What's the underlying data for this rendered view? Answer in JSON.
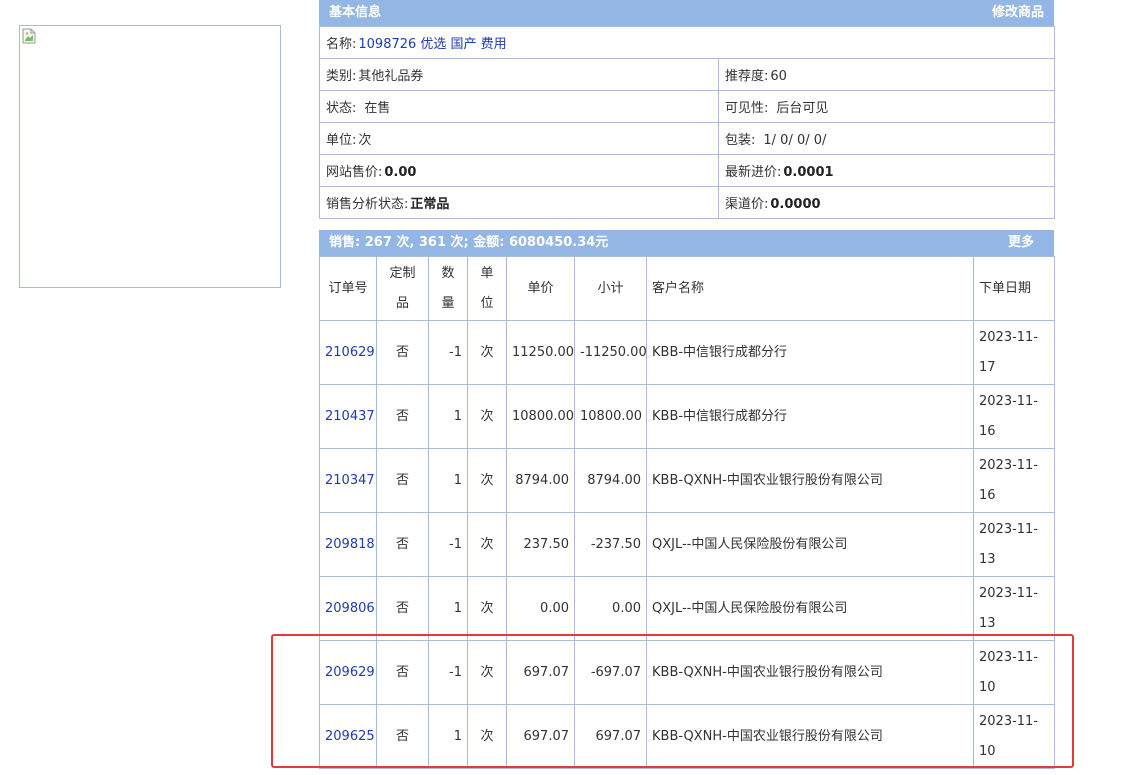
{
  "basic": {
    "header_title": "基本信息",
    "edit_link": "修改商品",
    "name_label": "名称:",
    "name_value": "1098726 优选 国产 费用",
    "category_label": "类别:",
    "category_value": "其他礼品券",
    "recommend_label": "推荐度:",
    "recommend_value": "60",
    "status_label": "状态:",
    "status_value": "在售",
    "visibility_label": "可见性:",
    "visibility_value": "后台可见",
    "unit_label": "单位:",
    "unit_value": "次",
    "package_label": "包装:",
    "package_value": "1/ 0/ 0/ 0/",
    "web_price_label": "网站售价:",
    "web_price_value": "0.00",
    "latest_cost_label": "最新进价:",
    "latest_cost_value": "0.0001",
    "sales_status_label": "销售分析状态:",
    "sales_status_value": "正常品",
    "channel_price_label": "渠道价:",
    "channel_price_value": "0.0000"
  },
  "sales": {
    "header_title": "销售: 267 次, 361 次; 金额: 6080450.34元",
    "more_link": "更多",
    "columns": {
      "order_no": "订单号",
      "custom_1": "定制",
      "custom_2": "品",
      "qty_1": "数",
      "qty_2": "量",
      "unit_1": "单",
      "unit_2": "位",
      "price": "单价",
      "subtotal": "小计",
      "customer": "客户名称",
      "date": "下单日期"
    },
    "rows": [
      {
        "order_no": "210629",
        "custom": "否",
        "qty": "-1",
        "unit": "次",
        "price": "11250.00",
        "subtotal": "-11250.00",
        "customer": "KBB-中信银行成都分行",
        "date_1": "2023-11-",
        "date_2": "17"
      },
      {
        "order_no": "210437",
        "custom": "否",
        "qty": "1",
        "unit": "次",
        "price": "10800.00",
        "subtotal": "10800.00",
        "customer": "KBB-中信银行成都分行",
        "date_1": "2023-11-",
        "date_2": "16"
      },
      {
        "order_no": "210347",
        "custom": "否",
        "qty": "1",
        "unit": "次",
        "price": "8794.00",
        "subtotal": "8794.00",
        "customer": "KBB-QXNH-中国农业银行股份有限公司",
        "date_1": "2023-11-",
        "date_2": "16"
      },
      {
        "order_no": "209818",
        "custom": "否",
        "qty": "-1",
        "unit": "次",
        "price": "237.50",
        "subtotal": "-237.50",
        "customer": "QXJL--中国人民保险股份有限公司",
        "date_1": "2023-11-",
        "date_2": "13"
      },
      {
        "order_no": "209806",
        "custom": "否",
        "qty": "1",
        "unit": "次",
        "price": "0.00",
        "subtotal": "0.00",
        "customer": "QXJL--中国人民保险股份有限公司",
        "date_1": "2023-11-",
        "date_2": "13"
      },
      {
        "order_no": "209629",
        "custom": "否",
        "qty": "-1",
        "unit": "次",
        "price": "697.07",
        "subtotal": "-697.07",
        "customer": "KBB-QXNH-中国农业银行股份有限公司",
        "date_1": "2023-11-",
        "date_2": "10"
      },
      {
        "order_no": "209625",
        "custom": "否",
        "qty": "1",
        "unit": "次",
        "price": "697.07",
        "subtotal": "697.07",
        "customer": "KBB-QXNH-中国农业银行股份有限公司",
        "date_1": "2023-11-",
        "date_2": "10"
      }
    ]
  },
  "colors": {
    "header_bg": "#93b6e4",
    "border": "#a9bdd4",
    "link": "#1d3bb2",
    "highlight": "#e23b3b"
  },
  "icons": {
    "product_image": "broken-image-icon"
  }
}
